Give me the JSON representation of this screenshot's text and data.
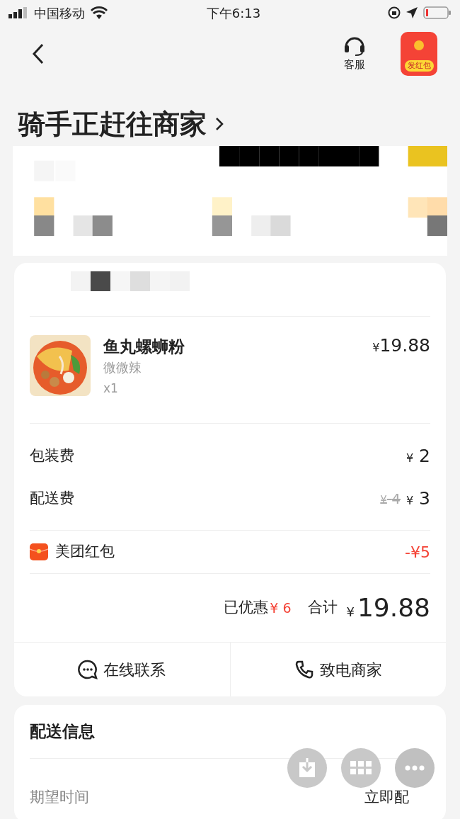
{
  "status_bar": {
    "carrier": "中国移动",
    "time": "下午6:13"
  },
  "nav": {
    "service_label": "客服",
    "red_packet_label": "发红包"
  },
  "title": "骑手正赶往商家",
  "order": {
    "item": {
      "name": "鱼丸螺蛳粉",
      "spec": "微微辣",
      "qty": "x1",
      "price": "19.88"
    },
    "fees": [
      {
        "label": "包装费",
        "price": "2"
      },
      {
        "label": "配送费",
        "original": "4",
        "price": "3"
      }
    ],
    "discount": {
      "label": "美团红包",
      "amount": "-¥5"
    },
    "summary": {
      "saved_label": "已优惠",
      "saved": "¥ 6",
      "total_label": "合计",
      "total": "19.88"
    },
    "actions": [
      {
        "kind": "chat",
        "label": "在线联系"
      },
      {
        "kind": "phone",
        "label": "致电商家"
      }
    ]
  },
  "delivery": {
    "title": "配送信息",
    "rows": [
      {
        "label": "期望时间",
        "value": "立即配"
      }
    ]
  },
  "currency": "¥"
}
